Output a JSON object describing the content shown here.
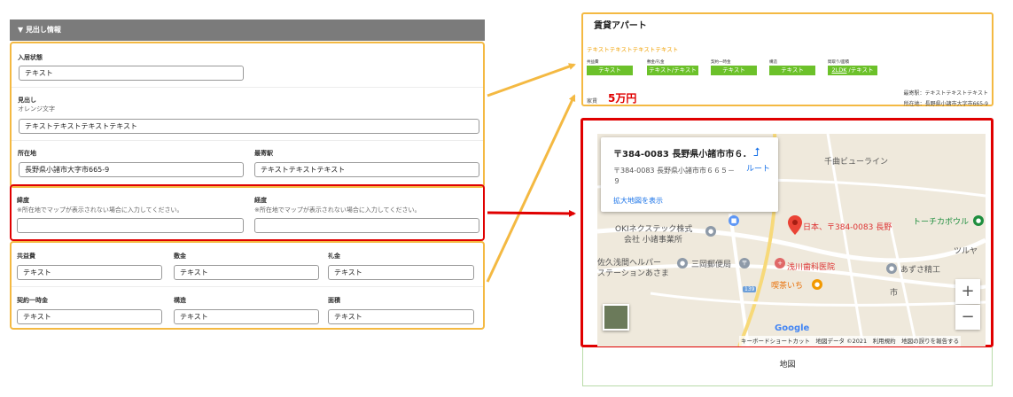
{
  "form": {
    "section_title": "▼ 見出し情報",
    "move_in": {
      "label": "入居状態",
      "value": "テキスト"
    },
    "heading": {
      "label": "見出し",
      "note": "オレンジ文字",
      "value": "テキストテキストテキストテキスト"
    },
    "address": {
      "label": "所在地",
      "value": "長野県小諸市大字市665-9"
    },
    "station": {
      "label": "最寄駅",
      "value": "テキストテキストテキスト"
    },
    "lat": {
      "label": "緯度",
      "note": "※所在地でマップが表示されない場合に入力してください。",
      "value": ""
    },
    "lng": {
      "label": "経度",
      "note": "※所在地でマップが表示されない場合に入力してください。",
      "value": ""
    },
    "common_fee": {
      "label": "共益費",
      "value": "テキスト"
    },
    "deposit": {
      "label": "敷金",
      "value": "テキスト"
    },
    "key_money": {
      "label": "礼金",
      "value": "テキスト"
    },
    "contract_fee": {
      "label": "契約一時金",
      "value": "テキスト"
    },
    "structure": {
      "label": "構造",
      "value": "テキスト"
    },
    "area": {
      "label": "面積",
      "value": "テキスト"
    }
  },
  "apartment": {
    "title": "賃貸アパート",
    "orange_text": "テキストテキストテキストテキスト",
    "tags": [
      {
        "label": "共益費",
        "value": "テキスト"
      },
      {
        "label": "敷金/礼金",
        "value": "テキスト/テキスト"
      },
      {
        "label": "契約一時金",
        "value": "テキスト"
      },
      {
        "label": "構造",
        "value": "テキスト"
      },
      {
        "label": "間取り/面積",
        "value_link": "2LDK",
        "value_rest": " /テキスト"
      }
    ],
    "rent_label": "家賃",
    "rent_value": "5万円",
    "station_line": "最寄駅：テキストテキストテキスト",
    "address_line": "所在地：長野県小諸市大字市665-9"
  },
  "map": {
    "card_title": "〒384-0083 長野県小諸市市６...",
    "card_address": "〒384-0083 長野県小諸市市６６５－９",
    "card_link": "拡大地図を表示",
    "route_label": "ルート",
    "pois": {
      "chikuma": "千曲ビューライン",
      "marker": "日本、〒384-0083 長野",
      "tochika": "トーチカボウル",
      "tsurya": "ツルヤ",
      "oki": "OKIネクステック株式",
      "oki2": "会社 小諸事業所",
      "kyuasama": "佐久浅間ヘルパー",
      "kyuasama2": "ステーションあさま",
      "post": "三岡郵便局",
      "dental": "浅川歯科医院",
      "azusa": "あずさ精工",
      "cafe": "喫茶いち",
      "ichi": "市",
      "route_no": "139"
    },
    "google_logo": "Google",
    "attribution": "キーボードショートカット　地図データ ©2021　利用規約　地図の誤りを報告する",
    "zoom_in": "+",
    "zoom_out": "−",
    "section_label": "地図"
  },
  "colors": {
    "orange": "#f4b942",
    "red": "#e00000",
    "green": "#6cc12a",
    "link": "#1a73e8"
  }
}
